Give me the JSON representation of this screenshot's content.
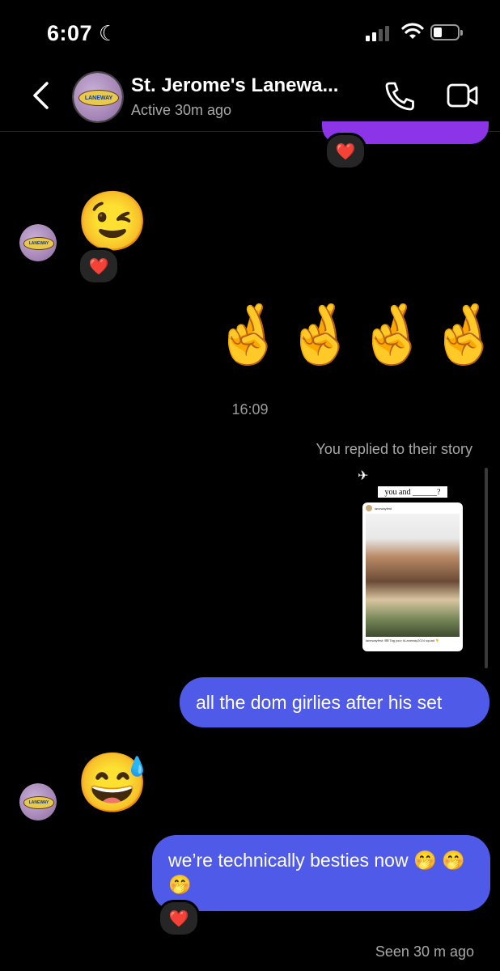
{
  "status_bar": {
    "time": "6:07",
    "moon": "☾"
  },
  "header": {
    "title": "St. Jerome's Lanewa...",
    "subtitle": "Active 30m ago",
    "avatar_text": "LANEWAY"
  },
  "messages": {
    "heart": "❤️",
    "wink": "😉",
    "crossed_fingers": [
      "🤞",
      "🤞",
      "🤞",
      "🤞"
    ],
    "timestamp": "16:09",
    "replied_label": "You replied to their story",
    "story": {
      "sticker": "you and ______?",
      "username": "lanewayfest",
      "caption": "lanewayfest: 🎟 Tag your #Laneway2024 squad 👇"
    },
    "bubble1": "all the dom girlies after his set",
    "sweat_smile": "😅",
    "bubble2": "we’re technically besties now 🤭 🤭 🤭",
    "seen": "Seen 30 m ago"
  }
}
